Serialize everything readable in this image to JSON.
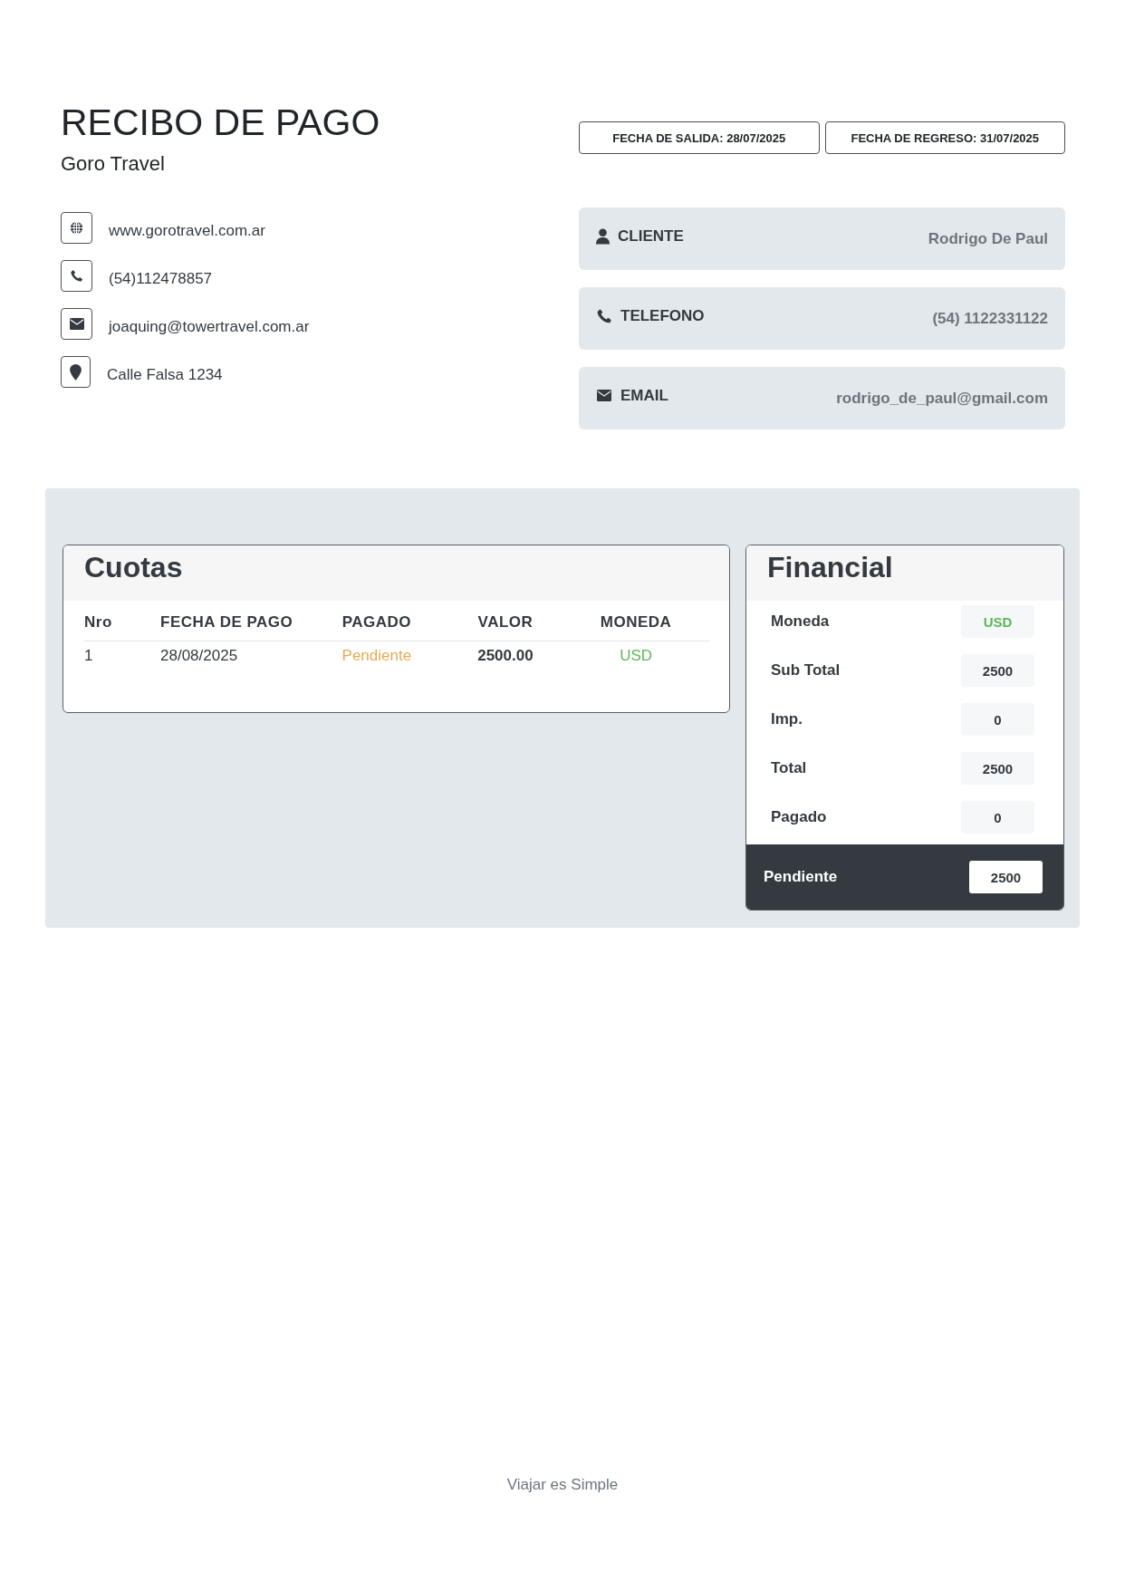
{
  "header": {
    "title": "RECIBO DE PAGO",
    "company": "Goro Travel"
  },
  "dates": [
    "FECHA DE SALIDA: 28/07/2025",
    "FECHA DE REGRESO: 31/07/2025"
  ],
  "contacts": [
    {
      "kind": "web",
      "text": "www.gorotravel.com.ar"
    },
    {
      "kind": "phone",
      "text": "(54)112478857"
    },
    {
      "kind": "email",
      "text": "joaquing@towertravel.com.ar"
    },
    {
      "kind": "location",
      "text": "Calle Falsa 1234"
    }
  ],
  "client_info": [
    {
      "kind": "client",
      "label": "CLIENTE",
      "value": "Rodrigo De Paul"
    },
    {
      "kind": "phone",
      "label": "TELEFONO",
      "value": "(54) 1122331122"
    },
    {
      "kind": "email",
      "label": "EMAIL",
      "value": "rodrigo_de_paul@gmail.com"
    }
  ],
  "cuotas": {
    "title": "Cuotas",
    "columns": [
      "Nro",
      "FECHA DE PAGO",
      "PAGADO",
      "VALOR",
      "MONEDA"
    ],
    "rows": [
      {
        "nro": "1",
        "fecha": "28/08/2025",
        "pagado": "Pendiente",
        "valor": "2500.00",
        "moneda": "USD"
      }
    ]
  },
  "financial": {
    "title": "Financial",
    "rows": [
      {
        "kind": "currency",
        "label": "Moneda",
        "value": "USD"
      },
      {
        "kind": "amount",
        "label": "Sub Total",
        "value": "2500"
      },
      {
        "kind": "amount",
        "label": "Imp.",
        "value": "0"
      },
      {
        "kind": "amount",
        "label": "Total",
        "value": "2500"
      },
      {
        "kind": "amount",
        "label": "Pagado",
        "value": "0"
      }
    ],
    "pending": {
      "label": "Pendiente",
      "value": "2500"
    }
  },
  "footer": "Viajar es Simple"
}
